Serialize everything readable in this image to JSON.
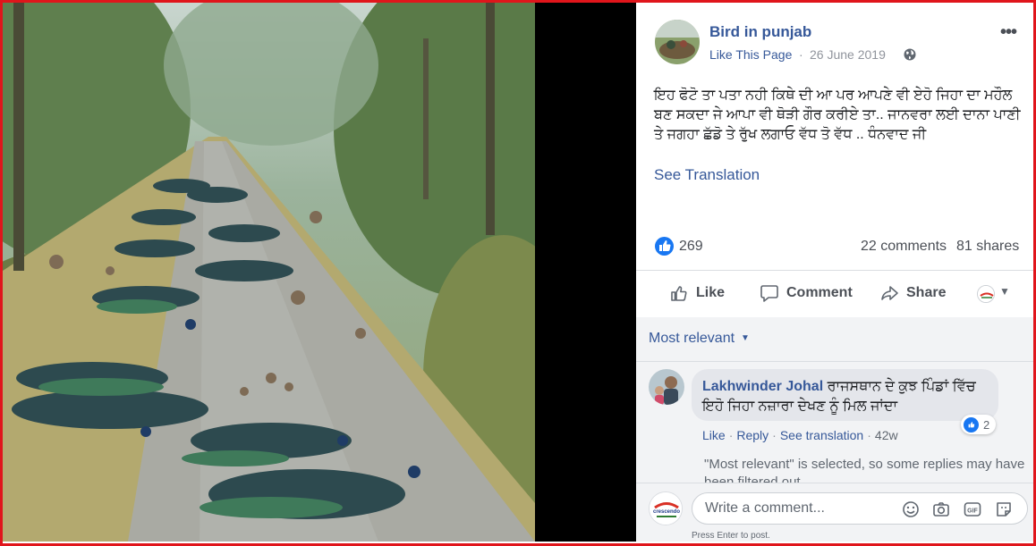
{
  "post": {
    "page_name": "Bird in punjab",
    "like_page": "Like This Page",
    "separator": "·",
    "date": "26 June 2019",
    "more": "•••",
    "text": "ਇਹ ਫੋਟੋ ਤਾ ਪਤਾ ਨਹੀ ਕਿਥੇ ਦੀ ਆ ਪਰ ਆਪਣੇ ਵੀ ਏਹੋ ਜਿਹਾ ਦਾ ਮਹੌਲ ਬਣ ਸਕਦਾ ਜੇ ਆਪਾ ਵੀ ਥੋੜੀ ਗੌਰ ਕਰੀਏ ਤਾ.. ਜਾਨਵਰਾ ਲਈ ਦਾਨਾ ਪਾਣੀ ਤੇ ਜਗਹਾ ਛੱਡੋ ਤੇ ਰੁੱਖ ਲਗਾਓ ਵੱਧ ਤੋ ਵੱਧ .. ਧੰਨਵਾਦ ਜੀ",
    "see_translation": "See Translation"
  },
  "stats": {
    "reactions": "269",
    "comments": "22 comments",
    "shares": "81 shares"
  },
  "actions": {
    "like": "Like",
    "comment": "Comment",
    "share": "Share"
  },
  "comments": {
    "sort_label": "Most relevant",
    "items": [
      {
        "name": "Lakhwinder Johal",
        "text": "ਰਾਜਸਥਾਨ ਦੇ ਕੁਝ ਪਿੰਡਾਂ ਵਿੱਚ ਇਹੋ ਜਿਹਾ ਨਜ਼ਾਰਾ ਦੇਖਣ ਨੂੰ ਮਿਲ ਜਾਂਦਾ",
        "reactions": "2",
        "like": "Like",
        "reply": "Reply",
        "see_translation": "See translation",
        "time": "42w"
      }
    ],
    "filter_note": "\"Most relevant\" is selected, so some replies may have been filtered out."
  },
  "composer": {
    "placeholder": "Write a comment...",
    "hint": "Press Enter to post."
  },
  "colors": {
    "link_blue": "#365899",
    "facebook_blue": "#1877f2",
    "frame_red": "#e0151b"
  },
  "icons": [
    "globe-icon",
    "more-options-icon",
    "like-reaction-icon",
    "thumbs-up-icon",
    "comment-icon",
    "share-icon",
    "emoji-icon",
    "camera-icon",
    "gif-icon",
    "sticker-icon"
  ]
}
